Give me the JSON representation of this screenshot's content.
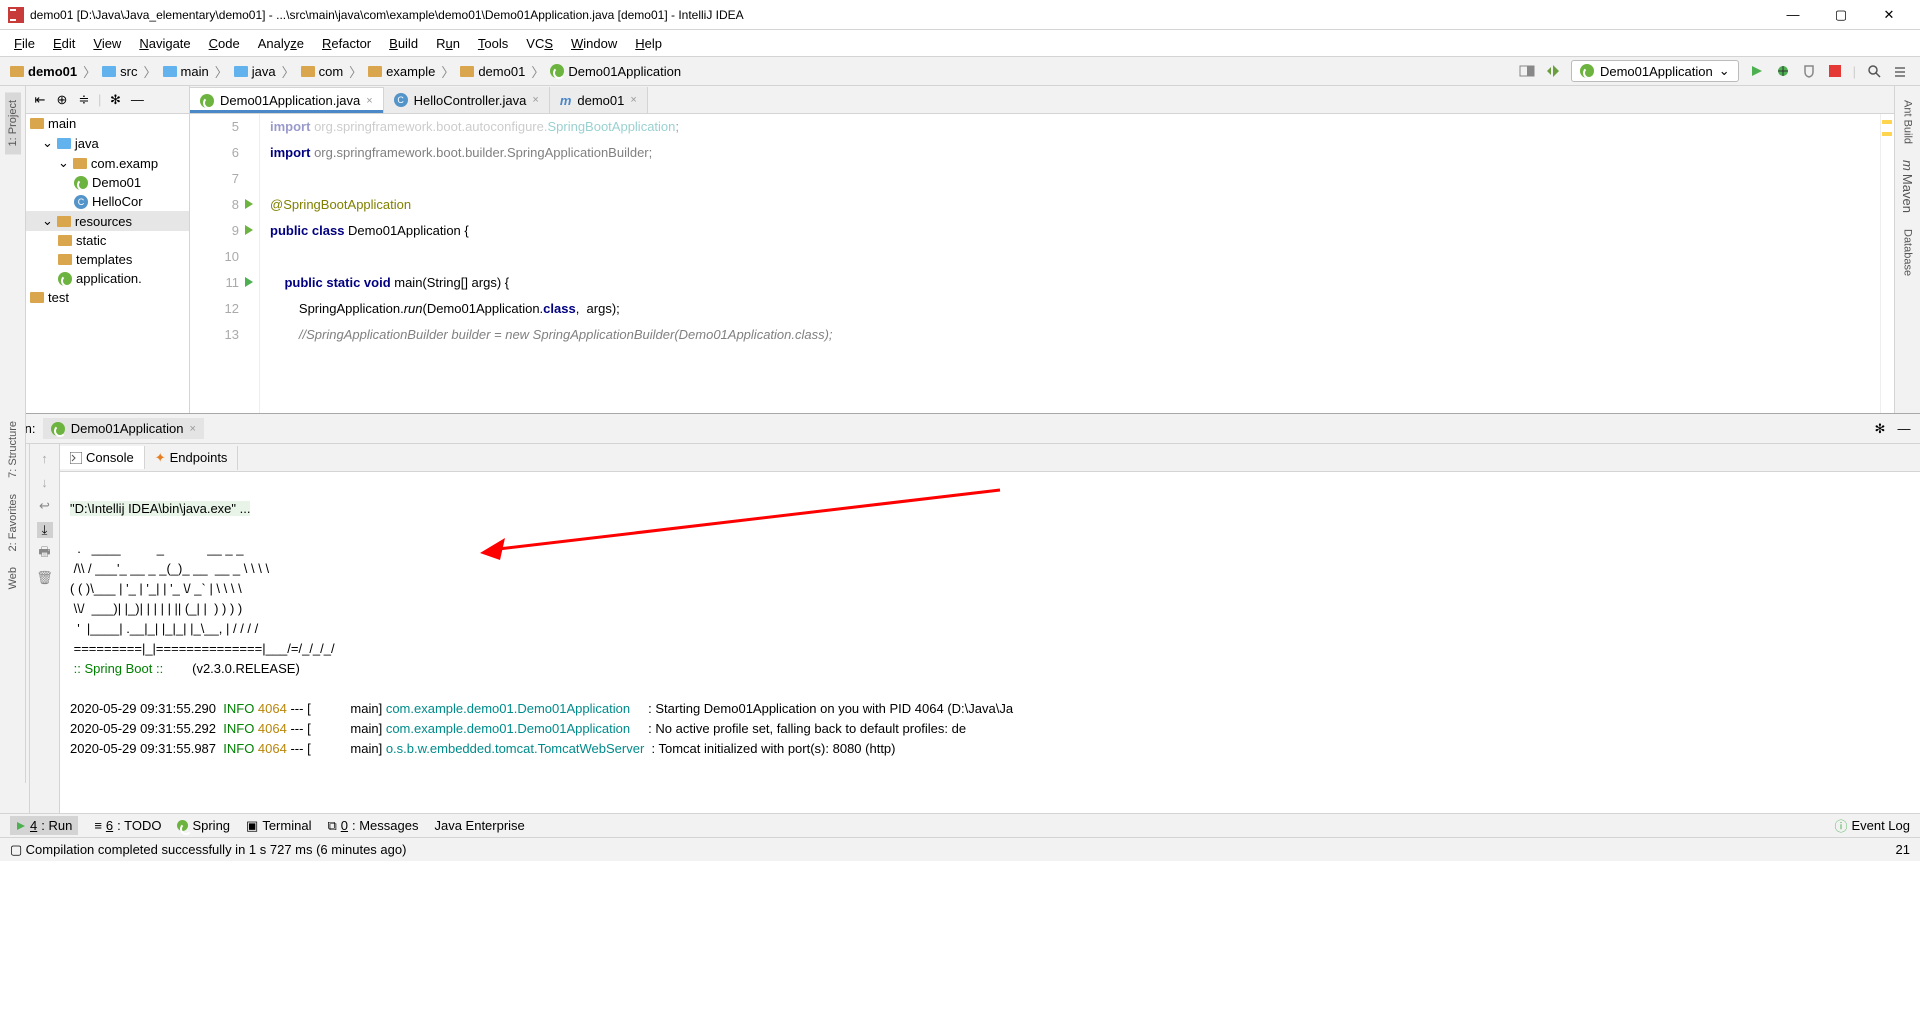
{
  "window": {
    "title": "demo01 [D:\\Java\\Java_elementary\\demo01] - ...\\src\\main\\java\\com\\example\\demo01\\Demo01Application.java [demo01] - IntelliJ IDEA"
  },
  "menu": {
    "file": "File",
    "edit": "Edit",
    "view": "View",
    "navigate": "Navigate",
    "code": "Code",
    "analyze": "Analyze",
    "refactor": "Refactor",
    "build": "Build",
    "run": "Run",
    "tools": "Tools",
    "vcs": "VCS",
    "window": "Window",
    "help": "Help"
  },
  "breadcrumb": [
    "demo01",
    "src",
    "main",
    "java",
    "com",
    "example",
    "demo01",
    "Demo01Application"
  ],
  "run_config": "Demo01Application",
  "left_tabs": {
    "project": "1: Project",
    "structure": "7: Structure",
    "favorites": "2: Favorites",
    "web": "Web"
  },
  "right_tabs": {
    "ant": "Ant Build",
    "maven": "Maven",
    "database": "Database"
  },
  "tree": {
    "main": "main",
    "java": "java",
    "pkg": "com.examp",
    "demo01app": "Demo01",
    "hello": "HelloCor",
    "resources": "resources",
    "static": "static",
    "templates": "templates",
    "application": "application.",
    "test": "test"
  },
  "tabs": [
    {
      "name": "Demo01Application.java",
      "active": true
    },
    {
      "name": "HelloController.java",
      "active": false
    },
    {
      "name": "demo01",
      "active": false
    }
  ],
  "code": {
    "l5": {
      "pre": "import ",
      "mid": "org.springframework.boot.autoconfigure.",
      "cls": "SpringBootApplication",
      "end": ";"
    },
    "l6": {
      "pre": "import ",
      "mid": "org.springframework.boot.builder.SpringApplicationBuilder;"
    },
    "l8": "@SpringBootApplication",
    "l9": {
      "a": "public class ",
      "b": "Demo01Application {"
    },
    "l11": {
      "a": "    public static void ",
      "b": "main(String[] args) {"
    },
    "l12": {
      "a": "        SpringApplication.",
      "b": "run",
      "c": "(Demo01Application.",
      "d": "class",
      "e": ",  args);"
    },
    "l13": "        //SpringApplicationBuilder builder = new SpringApplicationBuilder(Demo01Application.class);"
  },
  "line_numbers": [
    "5",
    "6",
    "7",
    "8",
    "9",
    "10",
    "11",
    "12",
    "13"
  ],
  "run_panel": {
    "label": "Run:",
    "name": "Demo01Application",
    "console_tab": "Console",
    "endpoints_tab": "Endpoints"
  },
  "console": {
    "cmd": "\"D:\\Intellij IDEA\\bin\\java.exe\" ...",
    "banner": "  .   ____          _            __ _ _\n /\\\\ / ___'_ __ _ _(_)_ __  __ _ \\ \\ \\ \\\n( ( )\\___ | '_ | '_| | '_ \\/ _` | \\ \\ \\ \\\n \\\\/  ___)| |_)| | | | | || (_| |  ) ) ) )\n  '  |____| .__|_| |_|_| |_\\__, | / / / /\n =========|_|==============|___/=/_/_/_/",
    "spring": " :: Spring Boot ::",
    "version": "        (v2.3.0.RELEASE)",
    "log1": {
      "ts": "2020-05-29 09:31:55.290  ",
      "lvl": "INFO ",
      "pid": "4064 ",
      "dash": "--- [",
      "thread": "           main] ",
      "pkg": "com.example.demo01.Demo01Application",
      "sep": "     : ",
      "msg": "Starting Demo01Application on you with PID 4064 (D:\\Java\\Ja"
    },
    "log2": {
      "ts": "2020-05-29 09:31:55.292  ",
      "lvl": "INFO ",
      "pid": "4064 ",
      "dash": "--- [",
      "thread": "           main] ",
      "pkg": "com.example.demo01.Demo01Application",
      "sep": "     : ",
      "msg": "No active profile set, falling back to default profiles: de"
    },
    "log3": {
      "ts": "2020-05-29 09:31:55.987  ",
      "lvl": "INFO ",
      "pid": "4064 ",
      "dash": "--- [",
      "thread": "           main] ",
      "pkg": "o.s.b.w.embedded.tomcat.TomcatWebServer",
      "sep": "  : ",
      "msg": "Tomcat initialized with port(s): 8080 (http)"
    }
  },
  "bottom": {
    "run": "4: Run",
    "todo": "6: TODO",
    "spring": "Spring",
    "terminal": "Terminal",
    "messages": "0: Messages",
    "javaee": "Java Enterprise",
    "eventlog": "Event Log"
  },
  "status": {
    "msg": "Compilation completed successfully in 1 s 727 ms (6 minutes ago)",
    "pos": "21"
  }
}
